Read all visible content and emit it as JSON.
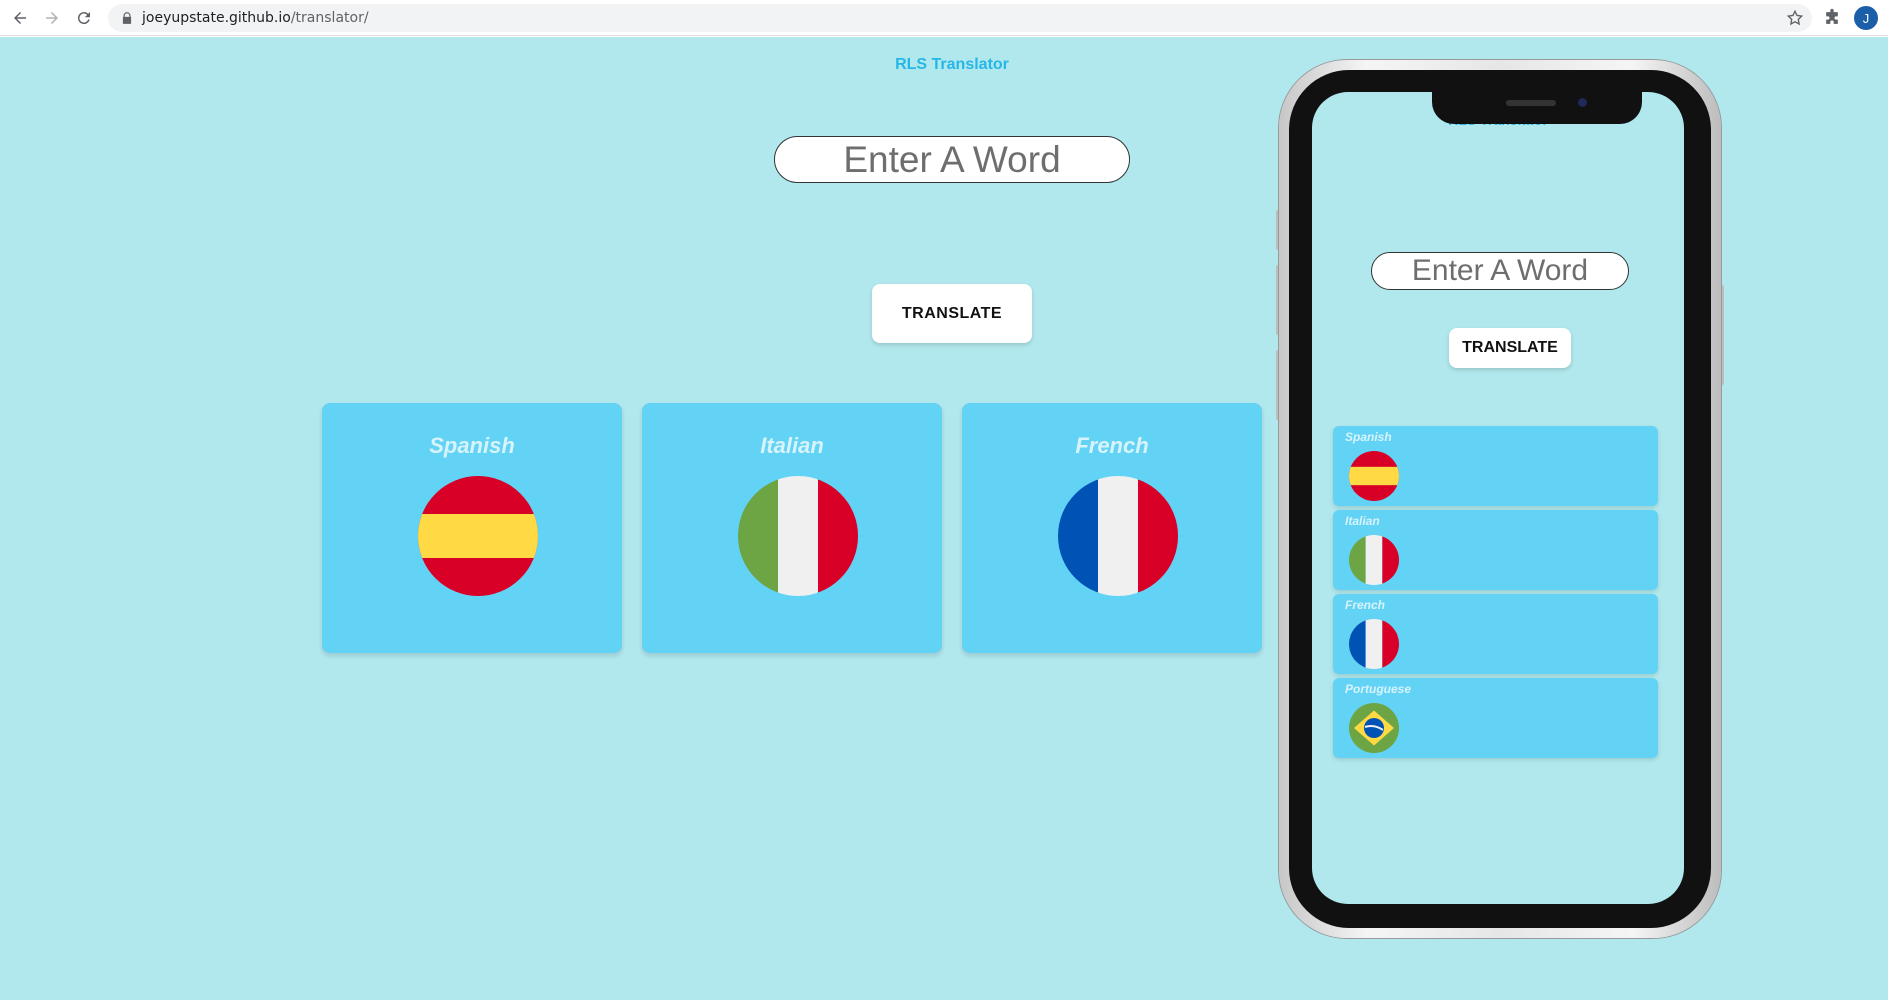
{
  "browser": {
    "url_host": "joeyupstate.github.io",
    "url_path": "/translator/",
    "avatar_letter": "J"
  },
  "page": {
    "title": "RLS Translator",
    "input_placeholder": "Enter A Word",
    "translate_label": "TRANSLATE",
    "languages": [
      {
        "name": "Spanish",
        "flag": "spain-flag-icon"
      },
      {
        "name": "Italian",
        "flag": "italy-flag-icon"
      },
      {
        "name": "French",
        "flag": "france-flag-icon"
      }
    ]
  },
  "mobile_preview": {
    "title": "RLS Translator",
    "input_placeholder": "Enter A Word",
    "translate_label": "TRANSLATE",
    "languages": [
      {
        "name": "Spanish",
        "flag": "spain-flag-icon"
      },
      {
        "name": "Italian",
        "flag": "italy-flag-icon"
      },
      {
        "name": "French",
        "flag": "france-flag-icon"
      },
      {
        "name": "Portuguese",
        "flag": "brazil-flag-icon"
      }
    ]
  },
  "colors": {
    "page_background": "#b0e8ed",
    "card_background": "#62d3f5",
    "accent": "#27b7e6"
  }
}
